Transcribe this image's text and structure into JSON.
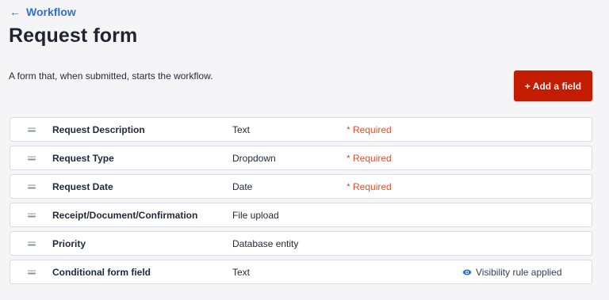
{
  "header": {
    "back_arrow": "←",
    "back_label": "Workflow",
    "title": "Request form",
    "description": "A form that, when submitted, starts the workflow."
  },
  "toolbar": {
    "add_field_label": "+ Add a field"
  },
  "colors": {
    "accent_link": "#2f6fd6",
    "add_button": "#c41c00",
    "required_text": "#d9532c",
    "eye_icon": "#2f6fd6"
  },
  "fields": [
    {
      "name": "Request Description",
      "type": "Text",
      "required": "* Required",
      "visibility": ""
    },
    {
      "name": "Request Type",
      "type": "Dropdown",
      "required": "* Required",
      "visibility": ""
    },
    {
      "name": "Request Date",
      "type": "Date",
      "required": "* Required",
      "visibility": ""
    },
    {
      "name": "Receipt/Document/Confirmation",
      "type": "File upload",
      "required": "",
      "visibility": ""
    },
    {
      "name": "Priority",
      "type": "Database entity",
      "required": "",
      "visibility": ""
    },
    {
      "name": "Conditional form field",
      "type": "Text",
      "required": "",
      "visibility": "Visibility rule applied"
    }
  ]
}
